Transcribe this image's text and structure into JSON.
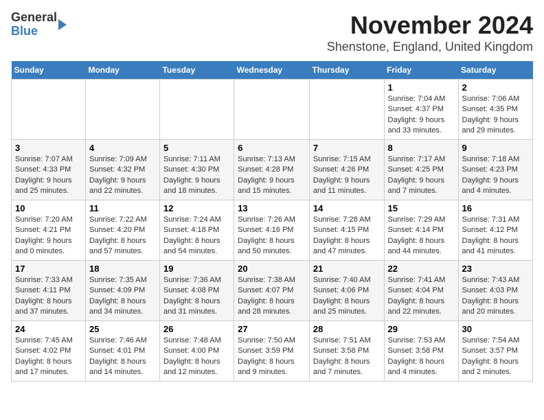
{
  "header": {
    "logo_general": "General",
    "logo_blue": "Blue",
    "month_title": "November 2024",
    "location": "Shenstone, England, United Kingdom"
  },
  "weekdays": [
    "Sunday",
    "Monday",
    "Tuesday",
    "Wednesday",
    "Thursday",
    "Friday",
    "Saturday"
  ],
  "weeks": [
    [
      {
        "day": "",
        "info": ""
      },
      {
        "day": "",
        "info": ""
      },
      {
        "day": "",
        "info": ""
      },
      {
        "day": "",
        "info": ""
      },
      {
        "day": "",
        "info": ""
      },
      {
        "day": "1",
        "info": "Sunrise: 7:04 AM\nSunset: 4:37 PM\nDaylight: 9 hours and 33 minutes."
      },
      {
        "day": "2",
        "info": "Sunrise: 7:06 AM\nSunset: 4:35 PM\nDaylight: 9 hours and 29 minutes."
      }
    ],
    [
      {
        "day": "3",
        "info": "Sunrise: 7:07 AM\nSunset: 4:33 PM\nDaylight: 9 hours and 25 minutes."
      },
      {
        "day": "4",
        "info": "Sunrise: 7:09 AM\nSunset: 4:32 PM\nDaylight: 9 hours and 22 minutes."
      },
      {
        "day": "5",
        "info": "Sunrise: 7:11 AM\nSunset: 4:30 PM\nDaylight: 9 hours and 18 minutes."
      },
      {
        "day": "6",
        "info": "Sunrise: 7:13 AM\nSunset: 4:28 PM\nDaylight: 9 hours and 15 minutes."
      },
      {
        "day": "7",
        "info": "Sunrise: 7:15 AM\nSunset: 4:26 PM\nDaylight: 9 hours and 11 minutes."
      },
      {
        "day": "8",
        "info": "Sunrise: 7:17 AM\nSunset: 4:25 PM\nDaylight: 9 hours and 7 minutes."
      },
      {
        "day": "9",
        "info": "Sunrise: 7:18 AM\nSunset: 4:23 PM\nDaylight: 9 hours and 4 minutes."
      }
    ],
    [
      {
        "day": "10",
        "info": "Sunrise: 7:20 AM\nSunset: 4:21 PM\nDaylight: 9 hours and 0 minutes."
      },
      {
        "day": "11",
        "info": "Sunrise: 7:22 AM\nSunset: 4:20 PM\nDaylight: 8 hours and 57 minutes."
      },
      {
        "day": "12",
        "info": "Sunrise: 7:24 AM\nSunset: 4:18 PM\nDaylight: 8 hours and 54 minutes."
      },
      {
        "day": "13",
        "info": "Sunrise: 7:26 AM\nSunset: 4:16 PM\nDaylight: 8 hours and 50 minutes."
      },
      {
        "day": "14",
        "info": "Sunrise: 7:28 AM\nSunset: 4:15 PM\nDaylight: 8 hours and 47 minutes."
      },
      {
        "day": "15",
        "info": "Sunrise: 7:29 AM\nSunset: 4:14 PM\nDaylight: 8 hours and 44 minutes."
      },
      {
        "day": "16",
        "info": "Sunrise: 7:31 AM\nSunset: 4:12 PM\nDaylight: 8 hours and 41 minutes."
      }
    ],
    [
      {
        "day": "17",
        "info": "Sunrise: 7:33 AM\nSunset: 4:11 PM\nDaylight: 8 hours and 37 minutes."
      },
      {
        "day": "18",
        "info": "Sunrise: 7:35 AM\nSunset: 4:09 PM\nDaylight: 8 hours and 34 minutes."
      },
      {
        "day": "19",
        "info": "Sunrise: 7:36 AM\nSunset: 4:08 PM\nDaylight: 8 hours and 31 minutes."
      },
      {
        "day": "20",
        "info": "Sunrise: 7:38 AM\nSunset: 4:07 PM\nDaylight: 8 hours and 28 minutes."
      },
      {
        "day": "21",
        "info": "Sunrise: 7:40 AM\nSunset: 4:06 PM\nDaylight: 8 hours and 25 minutes."
      },
      {
        "day": "22",
        "info": "Sunrise: 7:41 AM\nSunset: 4:04 PM\nDaylight: 8 hours and 22 minutes."
      },
      {
        "day": "23",
        "info": "Sunrise: 7:43 AM\nSunset: 4:03 PM\nDaylight: 8 hours and 20 minutes."
      }
    ],
    [
      {
        "day": "24",
        "info": "Sunrise: 7:45 AM\nSunset: 4:02 PM\nDaylight: 8 hours and 17 minutes."
      },
      {
        "day": "25",
        "info": "Sunrise: 7:46 AM\nSunset: 4:01 PM\nDaylight: 8 hours and 14 minutes."
      },
      {
        "day": "26",
        "info": "Sunrise: 7:48 AM\nSunset: 4:00 PM\nDaylight: 8 hours and 12 minutes."
      },
      {
        "day": "27",
        "info": "Sunrise: 7:50 AM\nSunset: 3:59 PM\nDaylight: 8 hours and 9 minutes."
      },
      {
        "day": "28",
        "info": "Sunrise: 7:51 AM\nSunset: 3:58 PM\nDaylight: 8 hours and 7 minutes."
      },
      {
        "day": "29",
        "info": "Sunrise: 7:53 AM\nSunset: 3:58 PM\nDaylight: 8 hours and 4 minutes."
      },
      {
        "day": "30",
        "info": "Sunrise: 7:54 AM\nSunset: 3:57 PM\nDaylight: 8 hours and 2 minutes."
      }
    ]
  ]
}
